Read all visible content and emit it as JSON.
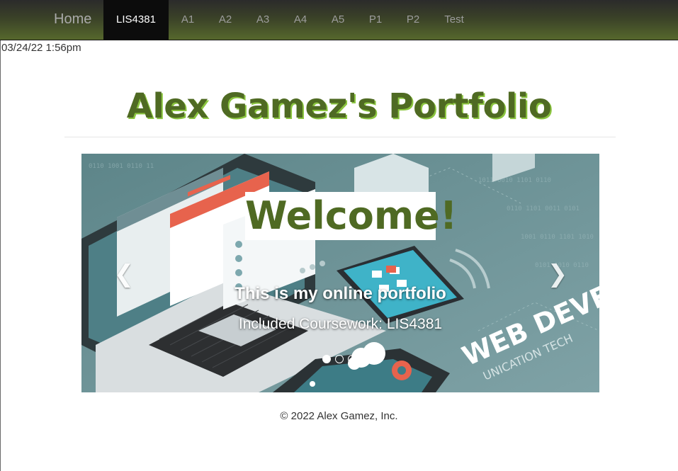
{
  "navbar": {
    "brand": "Home",
    "items": [
      {
        "label": "LIS4381",
        "active": true
      },
      {
        "label": "A1"
      },
      {
        "label": "A2"
      },
      {
        "label": "A3"
      },
      {
        "label": "A4"
      },
      {
        "label": "A5"
      },
      {
        "label": "P1"
      },
      {
        "label": "P2"
      },
      {
        "label": "Test"
      }
    ]
  },
  "timestamp": "03/24/22 1:56pm",
  "header": {
    "title": "Alex Gamez's Portfolio"
  },
  "carousel": {
    "welcome": "Welcome!",
    "caption_heading": "This is my online portfolio",
    "caption_text": "Included Coursework: LIS4381",
    "prev_icon": "chevron-left-icon",
    "next_icon": "chevron-right-icon",
    "slide_count": 3,
    "active_slide": 1
  },
  "footer": {
    "copyright": "© 2022 Alex Gamez, Inc."
  },
  "colors": {
    "accent": "#4f6a23",
    "accent_shadow": "#8bc53f",
    "nav_active": "#0c0c0c"
  }
}
